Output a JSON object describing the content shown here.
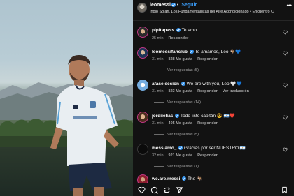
{
  "post": {
    "username": "leomessi",
    "follow_label": "Seguir",
    "audio_line": "Indio Solari, Los Fundamentalistas del Aire Acondicionado • Encuentro C"
  },
  "comments": [
    {
      "username": "pipitapass",
      "text": "Te amo",
      "time": "25 min",
      "likes": "",
      "reply": "Responder",
      "emoji": "",
      "verified": true,
      "view_replies": ""
    },
    {
      "username": "leomessifanclub",
      "text": "Te amamos, Leo 🐐💙",
      "time": "31 min",
      "likes": "828 Me gusta",
      "reply": "Responder",
      "verified": true,
      "view_replies": "Ver respuestas (5)"
    },
    {
      "username": "afaseleccion",
      "text": "We are with you, Leo 🤍💙",
      "time": "31 min",
      "likes": "823 Me gusta",
      "reply": "Responder",
      "translate": "Ver traducción",
      "verified": true,
      "view_replies": "Ver respuestas (14)"
    },
    {
      "username": "jordiielias",
      "text": "Todo listo capitán 😎 🇦🇷❤️",
      "time": "31 min",
      "likes": "405 Me gusta",
      "reply": "Responder",
      "verified": true,
      "view_replies": "Ver respuestas (5)"
    },
    {
      "username": "messiamo_",
      "text": "Gracias por ser NUESTRO 🇦🇷",
      "time": "32 min",
      "likes": "921 Me gusta",
      "reply": "Responder",
      "verified": true,
      "view_replies": "Ver respuestas (1)"
    },
    {
      "username": "we.are.messi",
      "text": "The 🐐",
      "time": "",
      "likes": "",
      "reply": "",
      "verified": true,
      "view_replies": ""
    }
  ],
  "icons": [
    "more-icon",
    "heart-icon",
    "comment-icon",
    "share-icon",
    "bookmark-icon"
  ],
  "colors": {
    "background": "#121212",
    "verified": "#3897f0",
    "follow": "#3897f0",
    "muted": "#a8a8a8"
  }
}
